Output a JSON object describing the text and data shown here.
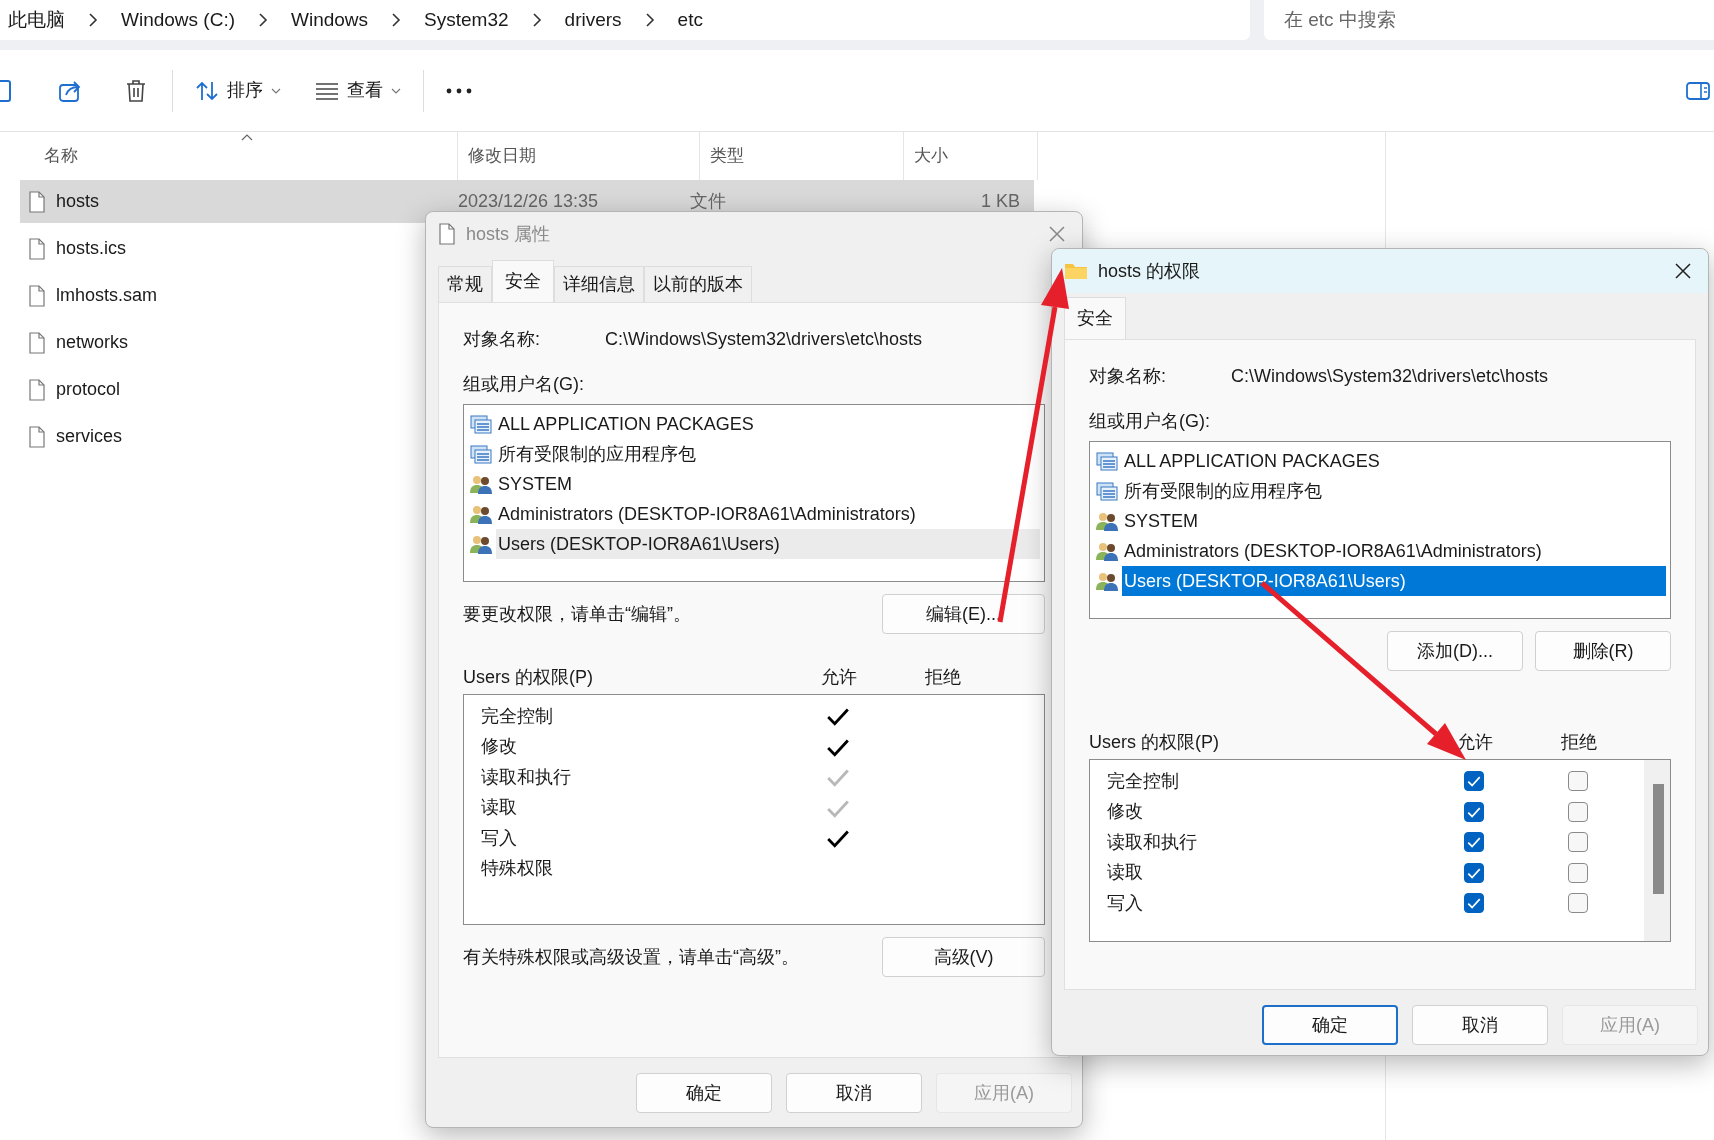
{
  "explorer": {
    "breadcrumb": [
      "此电脑",
      "Windows (C:)",
      "Windows",
      "System32",
      "drivers",
      "etc"
    ],
    "search": {
      "placeholder": "在 etc 中搜索"
    },
    "toolbar": {
      "sort_label": "排序",
      "view_label": "查看"
    },
    "columns": [
      {
        "label": "名称",
        "sorted": true
      },
      {
        "label": "修改日期",
        "sorted": false
      },
      {
        "label": "类型",
        "sorted": false
      },
      {
        "label": "大小",
        "sorted": false
      }
    ],
    "files": [
      {
        "name": "hosts",
        "modified": "2023/12/26 13:35",
        "type": "文件",
        "size": "1 KB",
        "selected": true
      },
      {
        "name": "hosts.ics",
        "selected": false
      },
      {
        "name": "lmhosts.sam",
        "selected": false
      },
      {
        "name": "networks",
        "selected": false
      },
      {
        "name": "protocol",
        "selected": false
      },
      {
        "name": "services",
        "selected": false
      }
    ]
  },
  "properties_dialog": {
    "title": "hosts 属性",
    "active": false,
    "tabs": [
      {
        "label": "常规",
        "selected": false
      },
      {
        "label": "安全",
        "selected": true
      },
      {
        "label": "详细信息",
        "selected": false
      },
      {
        "label": "以前的版本",
        "selected": false
      }
    ],
    "object_label": "对象名称:",
    "object_name": "C:\\Windows\\System32\\drivers\\etc\\hosts",
    "groups_label": "组或用户名(G):",
    "groups": [
      {
        "name": "ALL APPLICATION PACKAGES",
        "kind": "package",
        "selected": false
      },
      {
        "name": "所有受限制的应用程序包",
        "kind": "package",
        "selected": false
      },
      {
        "name": "SYSTEM",
        "kind": "users",
        "selected": false
      },
      {
        "name": "Administrators (DESKTOP-IOR8A61\\Administrators)",
        "kind": "users",
        "selected": false
      },
      {
        "name": "Users (DESKTOP-IOR8A61\\Users)",
        "kind": "users",
        "selected": true
      }
    ],
    "edit_hint": "要更改权限，请单击“编辑”。",
    "edit_button": "编辑(E)...",
    "permissions_label": "Users 的权限(P)",
    "allow_label": "允许",
    "deny_label": "拒绝",
    "permissions": [
      {
        "name": "完全控制",
        "kind": "mark",
        "allowed": true,
        "inherited": false
      },
      {
        "name": "修改",
        "kind": "mark",
        "allowed": true,
        "inherited": false
      },
      {
        "name": "读取和执行",
        "kind": "mark",
        "allowed": true,
        "inherited": true
      },
      {
        "name": "读取",
        "kind": "mark",
        "allowed": true,
        "inherited": true
      },
      {
        "name": "写入",
        "kind": "mark",
        "allowed": true,
        "inherited": false
      },
      {
        "name": "特殊权限",
        "kind": "mark",
        "allowed": false
      }
    ],
    "advanced_hint": "有关特殊权限或高级设置，请单击“高级”。",
    "advanced_button": "高级(V)",
    "buttons": [
      {
        "label": "确定",
        "disabled": false,
        "default": false
      },
      {
        "label": "取消",
        "disabled": false,
        "default": false
      },
      {
        "label": "应用(A)",
        "disabled": true,
        "default": false
      }
    ]
  },
  "permissions_dialog": {
    "title": "hosts 的权限",
    "active": true,
    "tabs": [
      {
        "label": "安全",
        "selected": true
      }
    ],
    "object_label": "对象名称:",
    "object_name": "C:\\Windows\\System32\\drivers\\etc\\hosts",
    "groups_label": "组或用户名(G):",
    "groups": [
      {
        "name": "ALL APPLICATION PACKAGES",
        "kind": "package",
        "selected": false
      },
      {
        "name": "所有受限制的应用程序包",
        "kind": "package",
        "selected": false
      },
      {
        "name": "SYSTEM",
        "kind": "users",
        "selected": false
      },
      {
        "name": "Administrators (DESKTOP-IOR8A61\\Administrators)",
        "kind": "users",
        "selected": false
      },
      {
        "name": "Users (DESKTOP-IOR8A61\\Users)",
        "kind": "users",
        "selected": true
      }
    ],
    "add_button": "添加(D)...",
    "remove_button": "删除(R)",
    "permissions_label": "Users 的权限(P)",
    "allow_label": "允许",
    "deny_label": "拒绝",
    "permissions": [
      {
        "name": "完全控制",
        "kind": "checkbox",
        "allowed": true,
        "denied": false
      },
      {
        "name": "修改",
        "kind": "checkbox",
        "allowed": true,
        "denied": false
      },
      {
        "name": "读取和执行",
        "kind": "checkbox",
        "allowed": true,
        "denied": false
      },
      {
        "name": "读取",
        "kind": "checkbox",
        "allowed": true,
        "denied": false
      },
      {
        "name": "写入",
        "kind": "checkbox",
        "allowed": true,
        "denied": false
      }
    ],
    "buttons": [
      {
        "label": "确定",
        "disabled": false,
        "default": true
      },
      {
        "label": "取消",
        "disabled": false,
        "default": false
      },
      {
        "label": "应用(A)",
        "disabled": true,
        "default": false
      }
    ]
  }
}
